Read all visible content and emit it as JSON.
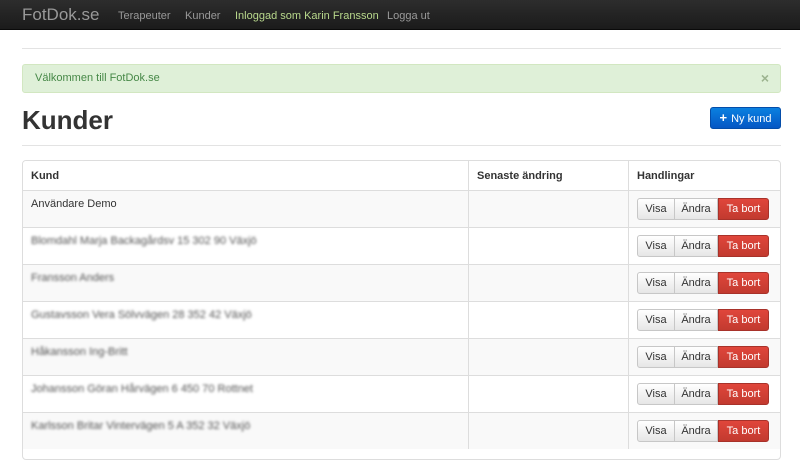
{
  "navbar": {
    "brand": "FotDok.se",
    "links": [
      "Terapeuter",
      "Kunder"
    ],
    "user_text": "Inloggad som Karin Fransson",
    "logout": "Logga ut"
  },
  "alert": {
    "message": "Välkommen till FotDok.se",
    "close": "×"
  },
  "page": {
    "title": "Kunder",
    "new_button": "Ny kund"
  },
  "table": {
    "headers": [
      "Kund",
      "Senaste ändring",
      "Handlingar"
    ],
    "rows": [
      {
        "kund": "Användare Demo",
        "changed": "",
        "blurred": false
      },
      {
        "kund": "Blomdahl Marja Backagårdsv 15 302 90 Växjö",
        "changed": "",
        "blurred": true
      },
      {
        "kund": "Fransson Anders",
        "changed": "",
        "blurred": true
      },
      {
        "kund": "Gustavsson Vera Sölvvägen 28 352 42 Växjö",
        "changed": "",
        "blurred": true
      },
      {
        "kund": "Håkansson Ing-Britt",
        "changed": "",
        "blurred": true
      },
      {
        "kund": "Johansson Göran Hårvägen 6 450 70 Rottnet",
        "changed": "",
        "blurred": true
      },
      {
        "kund": "Karlsson Britar Vintervägen 5 A 352 32 Växjö",
        "changed": "",
        "blurred": true
      }
    ],
    "actions": {
      "view": "Visa",
      "edit": "Ändra",
      "delete": "Ta bort"
    }
  }
}
